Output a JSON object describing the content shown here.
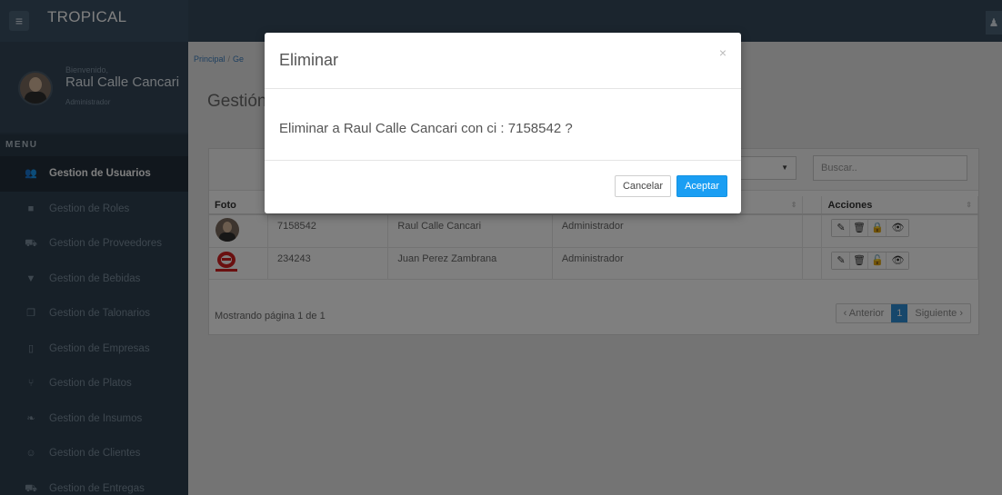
{
  "app": {
    "brand": "TROPICAL"
  },
  "user": {
    "welcome": "Bienvenido,",
    "name": "Raul Calle Cancari",
    "role": "Administrador"
  },
  "sidebar": {
    "menu_title": "MENU",
    "items": [
      {
        "label": "Gestion de Usuarios",
        "icon": "users-icon",
        "glyph": "👥",
        "active": true
      },
      {
        "label": "Gestion de Roles",
        "icon": "briefcase-icon",
        "glyph": "■"
      },
      {
        "label": "Gestion de Proveedores",
        "icon": "car-icon",
        "glyph": "⛟"
      },
      {
        "label": "Gestion de Bebidas",
        "icon": "beer-icon",
        "glyph": "▼"
      },
      {
        "label": "Gestion de Talonarios",
        "icon": "book-icon",
        "glyph": "❐"
      },
      {
        "label": "Gestion de Empresas",
        "icon": "building-icon",
        "glyph": "▯"
      },
      {
        "label": "Gestion de Platos",
        "icon": "cutlery-icon",
        "glyph": "⑂"
      },
      {
        "label": "Gestion de Insumos",
        "icon": "leaf-icon",
        "glyph": "❧"
      },
      {
        "label": "Gestion de Clientes",
        "icon": "smile-icon",
        "glyph": "☺"
      },
      {
        "label": "Gestion de Entregas",
        "icon": "truck-icon",
        "glyph": "⛟"
      }
    ]
  },
  "breadcrumb": {
    "home": "Principal",
    "current": "Ge"
  },
  "page": {
    "title": "Gestión"
  },
  "search": {
    "placeholder": "Buscar.."
  },
  "table": {
    "headers": {
      "foto": "Foto",
      "acciones": "Acciones"
    },
    "rows": [
      {
        "ci": "7158542",
        "nombre": "Raul Calle Cancari",
        "rol": "Administrador",
        "photo": "person-photo",
        "lock": "🔒"
      },
      {
        "ci": "234243",
        "nombre": "Juan Perez Zambrana",
        "rol": "Administrador",
        "photo": "company-logo",
        "lock": "🔓"
      }
    ],
    "footer": "Mostrando página 1 de 1"
  },
  "pager": {
    "prev": "‹ Anterior",
    "current": "1",
    "next": "Siguiente ›"
  },
  "modal": {
    "title": "Eliminar",
    "close": "×",
    "message": "Eliminar a Raul Calle Cancari con ci : 7158542 ?",
    "cancel": "Cancelar",
    "accept": "Aceptar"
  },
  "colors": {
    "sidebar": "#2f4050",
    "topbar": "#374a5c",
    "accent": "#1a9ef3"
  }
}
